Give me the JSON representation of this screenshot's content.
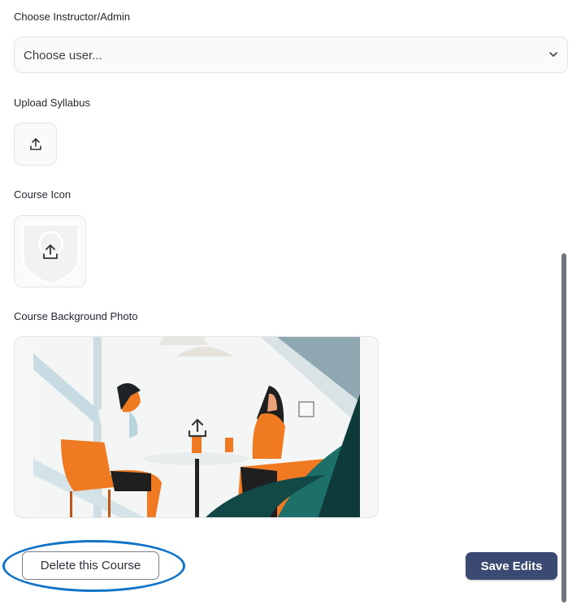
{
  "instructor": {
    "label": "Choose Instructor/Admin",
    "select_placeholder": "Choose user..."
  },
  "syllabus": {
    "label": "Upload Syllabus"
  },
  "course_icon": {
    "label": "Course Icon"
  },
  "background_photo": {
    "label": "Course Background Photo"
  },
  "actions": {
    "delete_label": "Delete this Course",
    "save_label": "Save Edits"
  },
  "colors": {
    "primary": "#3b4a72",
    "highlight_ring": "#1173c8",
    "border": "#e4e4e7",
    "field_bg": "#fafafa"
  },
  "icons": [
    "chevron-down-icon",
    "upload-icon"
  ]
}
